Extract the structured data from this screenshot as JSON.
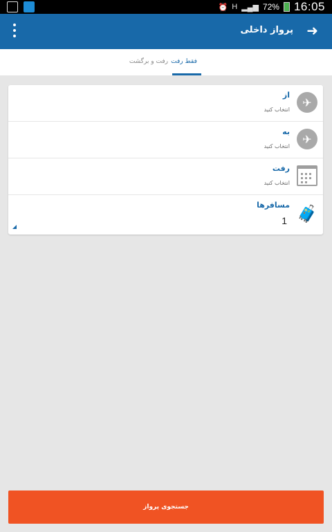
{
  "status_bar": {
    "time": "16:05",
    "battery": "72%",
    "network": "H",
    "icons": [
      "image-icon",
      "wifi-icon",
      "alarm-icon",
      "signal-icon",
      "battery-icon"
    ]
  },
  "app_bar": {
    "title": "پرواز داخلی",
    "back_icon": "arrow-right-icon",
    "menu_icon": "overflow-menu-icon"
  },
  "tabs": [
    {
      "label": "فقط رفت",
      "selected": true
    },
    {
      "label": "رفت و برگشت",
      "selected": false
    }
  ],
  "form": {
    "from": {
      "label": "از",
      "placeholder": "انتخاب کنید",
      "icon": "takeoff-icon"
    },
    "to": {
      "label": "به",
      "placeholder": "انتخاب کنید",
      "icon": "landing-icon"
    },
    "depart": {
      "label": "رفت",
      "placeholder": "انتخاب کنید",
      "icon": "calendar-icon"
    },
    "passengers": {
      "label": "مسافرها",
      "count": "1",
      "icon": "traveler-icon"
    }
  },
  "search_button": {
    "label": "جستجوی پرواز"
  },
  "colors": {
    "primary": "#1869a9",
    "accent": "#f05323",
    "background": "#e6e6e6"
  }
}
